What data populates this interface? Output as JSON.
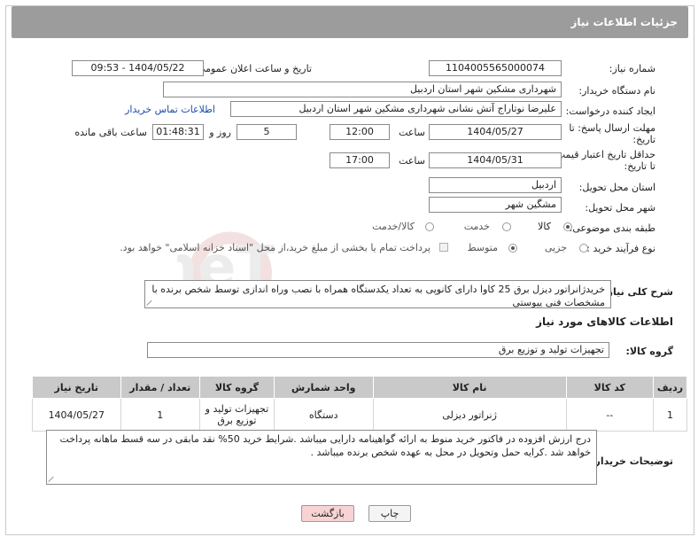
{
  "header": {
    "title": "جزئیات اطلاعات نیاز"
  },
  "fields": {
    "need_number_label": "شماره نیاز:",
    "need_number": "1104005565000074",
    "announce_label": "تاریخ و ساعت اعلان عمومی:",
    "announce_value": "1404/05/22 - 09:53",
    "buyer_org_label": "نام دستگاه خریدار:",
    "buyer_org": "شهرداری مشکین شهر استان اردبیل",
    "requester_label": "ایجاد کننده درخواست:",
    "requester": "علیرضا نوتاراج آتش نشانی شهرداری مشکین شهر استان اردبیل",
    "contact_link": "اطلاعات تماس خریدار",
    "reply_deadline_label_1": "مهلت ارسال پاسخ: تا",
    "reply_deadline_label_2": "تاریخ:",
    "reply_date": "1404/05/27",
    "time_label": "ساعت",
    "reply_time": "12:00",
    "days": "5",
    "days_label": "روز و",
    "remaining": "01:48:31",
    "remaining_label": "ساعت باقی مانده",
    "validity_label_1": "حداقل تاریخ اعتبار قیمت:",
    "validity_label_2": "تا تاریخ:",
    "validity_date": "1404/05/31",
    "validity_time_label": "ساعت",
    "validity_time": "17:00",
    "province_label": "استان محل تحویل:",
    "province": "اردبیل",
    "city_label": "شهر محل تحویل:",
    "city": "مشگین شهر",
    "category_label": "طبقه بندی موضوعی:",
    "category_options": [
      "کالا",
      "خدمت",
      "کالا/خدمت"
    ],
    "process_label": "نوع فرآیند خرید :",
    "process_options": [
      "جزیی",
      "متوسط"
    ],
    "payment_note": "پرداخت تمام یا بخشی از مبلغ خرید،از محل \"اسناد خزانه اسلامی\" خواهد بود.",
    "description_label": "شرح کلی نیاز:",
    "description": "خریدژانراتور دیزل برق 25 کاوا دارای کانوپی به تعداد یکدستگاه همراه با نصب وراه اندازی توسط شخص برنده با مشخصات فنی پیوستی"
  },
  "goods": {
    "section_title": "اطلاعات کالاهای مورد نیاز",
    "group_label": "گروه کالا:",
    "group_value": "تجهیزات تولید و توزیع برق",
    "columns": [
      "ردیف",
      "کد کالا",
      "نام کالا",
      "واحد شمارش",
      "گروه کالا",
      "تعداد / مقدار",
      "تاریخ نیاز"
    ],
    "rows": [
      {
        "row": "1",
        "code": "--",
        "name": "ژنراتور دیزلی",
        "unit": "دستگاه",
        "group": "تجهیزات تولید و توزیع برق",
        "qty": "1",
        "date": "1404/05/27"
      }
    ]
  },
  "buyer_notes": {
    "label": "توضیحات خریدار:",
    "text": "درج ارزش افزوده در فاکتور خرید منوط به ارائه گواهینامه دارایی میباشد .شرایط خرید 50% نقد مابقی در سه قسط ماهانه پرداخت خواهد شد .کرایه حمل وتحویل در محل به عهده شخص برنده میباشد ."
  },
  "buttons": {
    "print": "چاپ",
    "back": "بازگشت"
  },
  "watermark": {
    "text": "AriaTender.neT"
  },
  "colors": {
    "header_bg": "#9c9c9c",
    "link": "#1a4db3",
    "back_btn": "#f7d3d3"
  }
}
